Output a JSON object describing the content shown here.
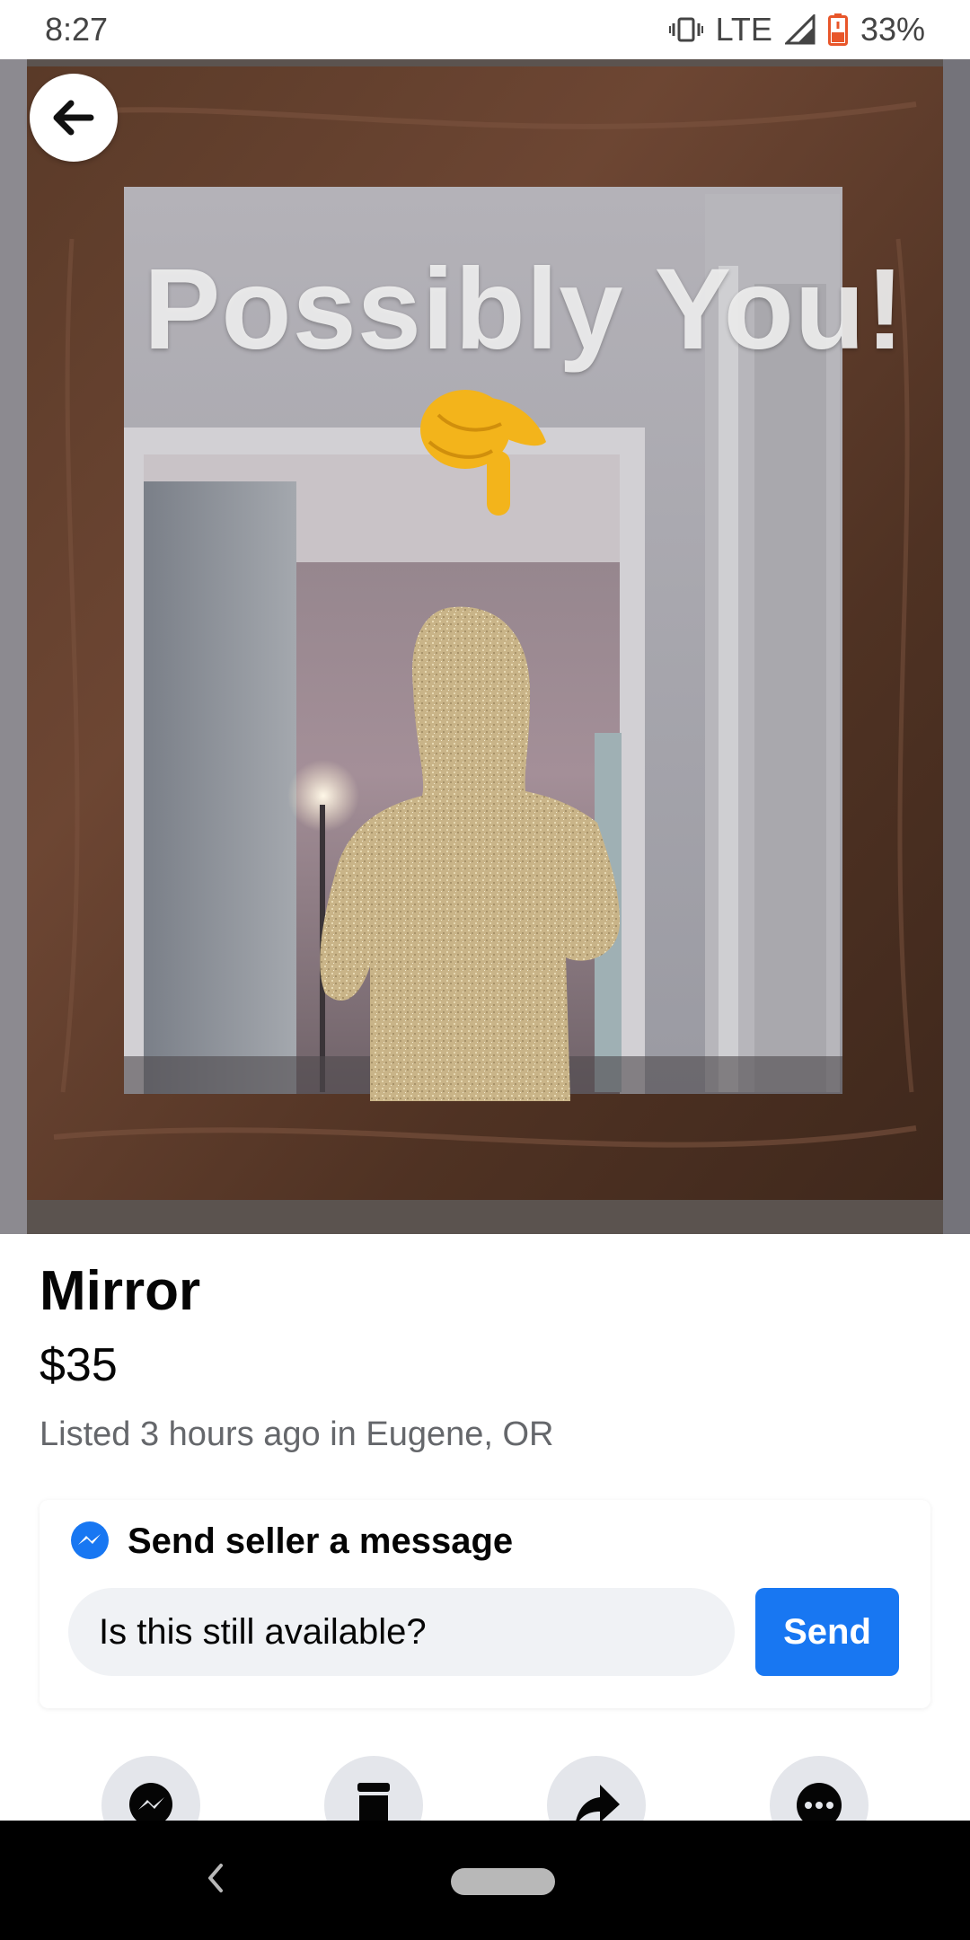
{
  "status_bar": {
    "time": "8:27",
    "network": "LTE",
    "battery": "33%",
    "icons": [
      "vibrate-icon",
      "signal-icon",
      "battery-icon"
    ]
  },
  "photo": {
    "overlay_text": "Possibly You!",
    "overlay_emoji": "👇"
  },
  "listing": {
    "title": "Mirror",
    "price": "$35",
    "meta": "Listed 3 hours ago in Eugene, OR"
  },
  "message": {
    "header": "Send seller a message",
    "input_value": "Is this still available?",
    "send_label": "Send"
  },
  "actions": [
    "messenger-icon",
    "save-icon",
    "share-icon",
    "more-icon"
  ],
  "colors": {
    "accent": "#1877f2",
    "secondary_text": "#65676b",
    "input_bg": "#f0f2f5"
  }
}
